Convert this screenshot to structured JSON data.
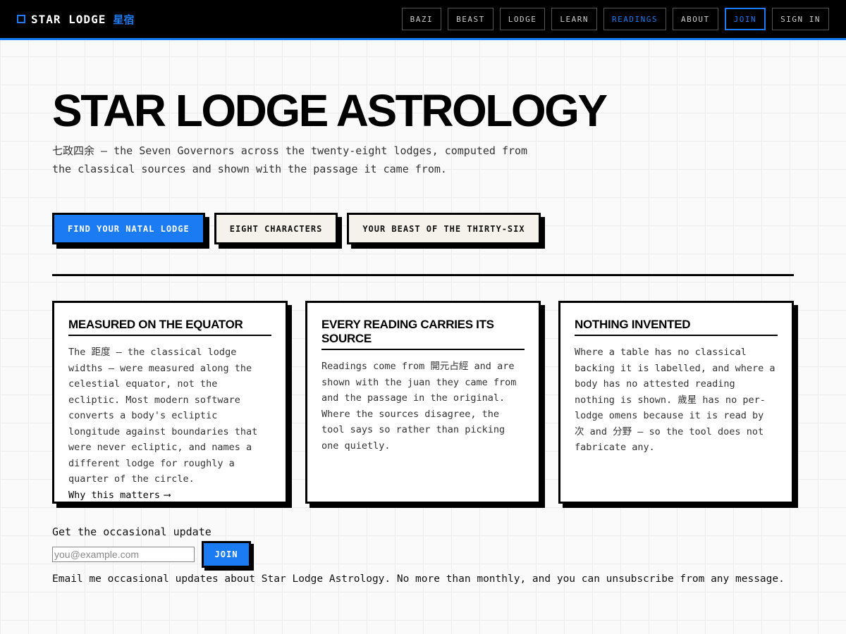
{
  "brand": {
    "name": "STAR LODGE",
    "cjk": "星宿",
    "icon": "square-outline-icon"
  },
  "nav": [
    {
      "label": "BAZI"
    },
    {
      "label": "BEAST"
    },
    {
      "label": "LODGE"
    },
    {
      "label": "LEARN"
    },
    {
      "label": "READINGS"
    },
    {
      "label": "ABOUT"
    },
    {
      "label": "JOIN"
    },
    {
      "label": "SIGN IN"
    }
  ],
  "hero": {
    "title": "STAR LODGE ASTROLOGY",
    "subtitle": "七政四余 — the Seven Governors across the twenty-eight lodges, computed from the classical sources and shown with the passage it came from."
  },
  "cta": {
    "primary": "FIND YOUR NATAL LODGE",
    "secondary": "EIGHT CHARACTERS",
    "tertiary": "YOUR BEAST OF THE THIRTY-SIX"
  },
  "cards": [
    {
      "title": "MEASURED ON THE EQUATOR",
      "body": "The 距度 — the classical lodge widths — were measured along the celestial equator, not the ecliptic. Most modern software converts a body's ecliptic longitude against boundaries that were never ecliptic, and names a different lodge for roughly a quarter of the circle.",
      "link": "Why this matters",
      "link_icon": "arrow-right-icon"
    },
    {
      "title": "EVERY READING CARRIES ITS SOURCE",
      "body": "Readings come from 開元占經 and are shown with the juan they came from and the passage in the original. Where the sources disagree, the tool says so rather than picking one quietly."
    },
    {
      "title": "NOTHING INVENTED",
      "body": "Where a table has no classical backing it is labelled, and where a body has no attested reading nothing is shown. 歲星 has no per-lodge omens because it is read by 次 and 分野 — so the tool does not fabricate any."
    }
  ],
  "newsletter": {
    "label": "Get the occasional update",
    "placeholder": "you@example.com",
    "submit": "JOIN",
    "consent": "Email me occasional updates about Star Lodge Astrology. No more than monthly, and you can unsubscribe from any message."
  },
  "colors": {
    "accent": "#1a7bf2",
    "ink": "#000000",
    "paper": "#fafafa",
    "button_paper": "#f4f2ea"
  }
}
